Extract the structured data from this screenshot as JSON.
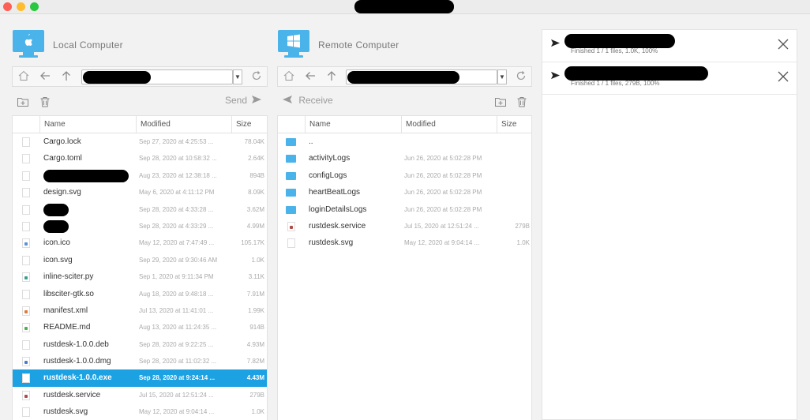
{
  "window": {
    "title_redacted": true
  },
  "local": {
    "title": "Local Computer",
    "action_label": "Send",
    "columns": [
      "Name",
      "Modified",
      "Size"
    ],
    "files": [
      {
        "name": "Cargo.lock",
        "modified": "Sep 27, 2020 at 4:25:53 ...",
        "size": "78.04K",
        "icon": "file-icon"
      },
      {
        "name": "Cargo.toml",
        "modified": "Sep 28, 2020 at 10:58:32 ...",
        "size": "2.64K",
        "icon": "file-icon"
      },
      {
        "name": "",
        "modified": "Aug 23, 2020 at 12:38:18 ...",
        "size": "894B",
        "icon": "file-icon",
        "redacted": true
      },
      {
        "name": "design.svg",
        "modified": "May 6, 2020 at 4:11:12 PM",
        "size": "8.09K",
        "icon": "file-icon"
      },
      {
        "name": "",
        "modified": "Sep 28, 2020 at 4:33:28 ...",
        "size": "3.62M",
        "icon": "file-icon",
        "redacted": true
      },
      {
        "name": "",
        "modified": "Sep 28, 2020 at 4:33:29 ...",
        "size": "4.99M",
        "icon": "file-icon",
        "redacted": true
      },
      {
        "name": "icon.ico",
        "modified": "May 12, 2020 at 7:47:49 ...",
        "size": "105.17K",
        "icon": "ico-file-icon"
      },
      {
        "name": "icon.svg",
        "modified": "Sep 29, 2020 at 9:30:46 AM",
        "size": "1.0K",
        "icon": "file-icon"
      },
      {
        "name": "inline-sciter.py",
        "modified": "Sep 1, 2020 at 9:11:34 PM",
        "size": "3.11K",
        "icon": "python-file-icon"
      },
      {
        "name": "libsciter-gtk.so",
        "modified": "Aug 18, 2020 at 9:48:18 ...",
        "size": "7.91M",
        "icon": "file-icon"
      },
      {
        "name": "manifest.xml",
        "modified": "Jul 13, 2020 at 11:41:01 ...",
        "size": "1.99K",
        "icon": "xml-file-icon"
      },
      {
        "name": "README.md",
        "modified": "Aug 13, 2020 at 11:24:35 ...",
        "size": "914B",
        "icon": "markdown-file-icon"
      },
      {
        "name": "rustdesk-1.0.0.deb",
        "modified": "Sep 28, 2020 at 9:22:25 ...",
        "size": "4.93M",
        "icon": "file-icon"
      },
      {
        "name": "rustdesk-1.0.0.dmg",
        "modified": "Sep 28, 2020 at 11:02:32 ...",
        "size": "7.82M",
        "icon": "dmg-file-icon"
      },
      {
        "name": "rustdesk-1.0.0.exe",
        "modified": "Sep 28, 2020 at 9:24:14 ...",
        "size": "4.43M",
        "icon": "file-icon",
        "selected": true
      },
      {
        "name": "rustdesk.service",
        "modified": "Jul 15, 2020 at 12:51:24 ...",
        "size": "279B",
        "icon": "service-file-icon"
      },
      {
        "name": "rustdesk.svg",
        "modified": "May 12, 2020 at 9:04:14 ...",
        "size": "1.0K",
        "icon": "file-icon"
      }
    ]
  },
  "remote": {
    "title": "Remote Computer",
    "action_label": "Receive",
    "columns": [
      "Name",
      "Modified",
      "Size"
    ],
    "files": [
      {
        "name": "..",
        "modified": "",
        "size": "",
        "icon": "folder-icon"
      },
      {
        "name": "activityLogs",
        "modified": "Jun 26, 2020 at 5:02:28 PM",
        "size": "",
        "icon": "folder-icon"
      },
      {
        "name": "configLogs",
        "modified": "Jun 26, 2020 at 5:02:28 PM",
        "size": "",
        "icon": "folder-icon"
      },
      {
        "name": "heartBeatLogs",
        "modified": "Jun 26, 2020 at 5:02:28 PM",
        "size": "",
        "icon": "folder-icon"
      },
      {
        "name": "loginDetailsLogs",
        "modified": "Jun 26, 2020 at 5:02:28 PM",
        "size": "",
        "icon": "folder-icon"
      },
      {
        "name": "rustdesk.service",
        "modified": "Jul 15, 2020 at 12:51:24 ...",
        "size": "279B",
        "icon": "service-file-icon"
      },
      {
        "name": "rustdesk.svg",
        "modified": "May 12, 2020 at 9:04:14 ...",
        "size": "1.0K",
        "icon": "file-icon"
      }
    ]
  },
  "transfers": [
    {
      "status": "Finished 1 / 1 files, 1.0K, 100%",
      "direction": "send"
    },
    {
      "status": "Finished 1 / 1 files, 279B, 100%",
      "direction": "receive"
    }
  ],
  "colors": {
    "selection": "#1ca1e2",
    "folder": "#4ab3ea",
    "monitor": "#4ab3ea"
  }
}
